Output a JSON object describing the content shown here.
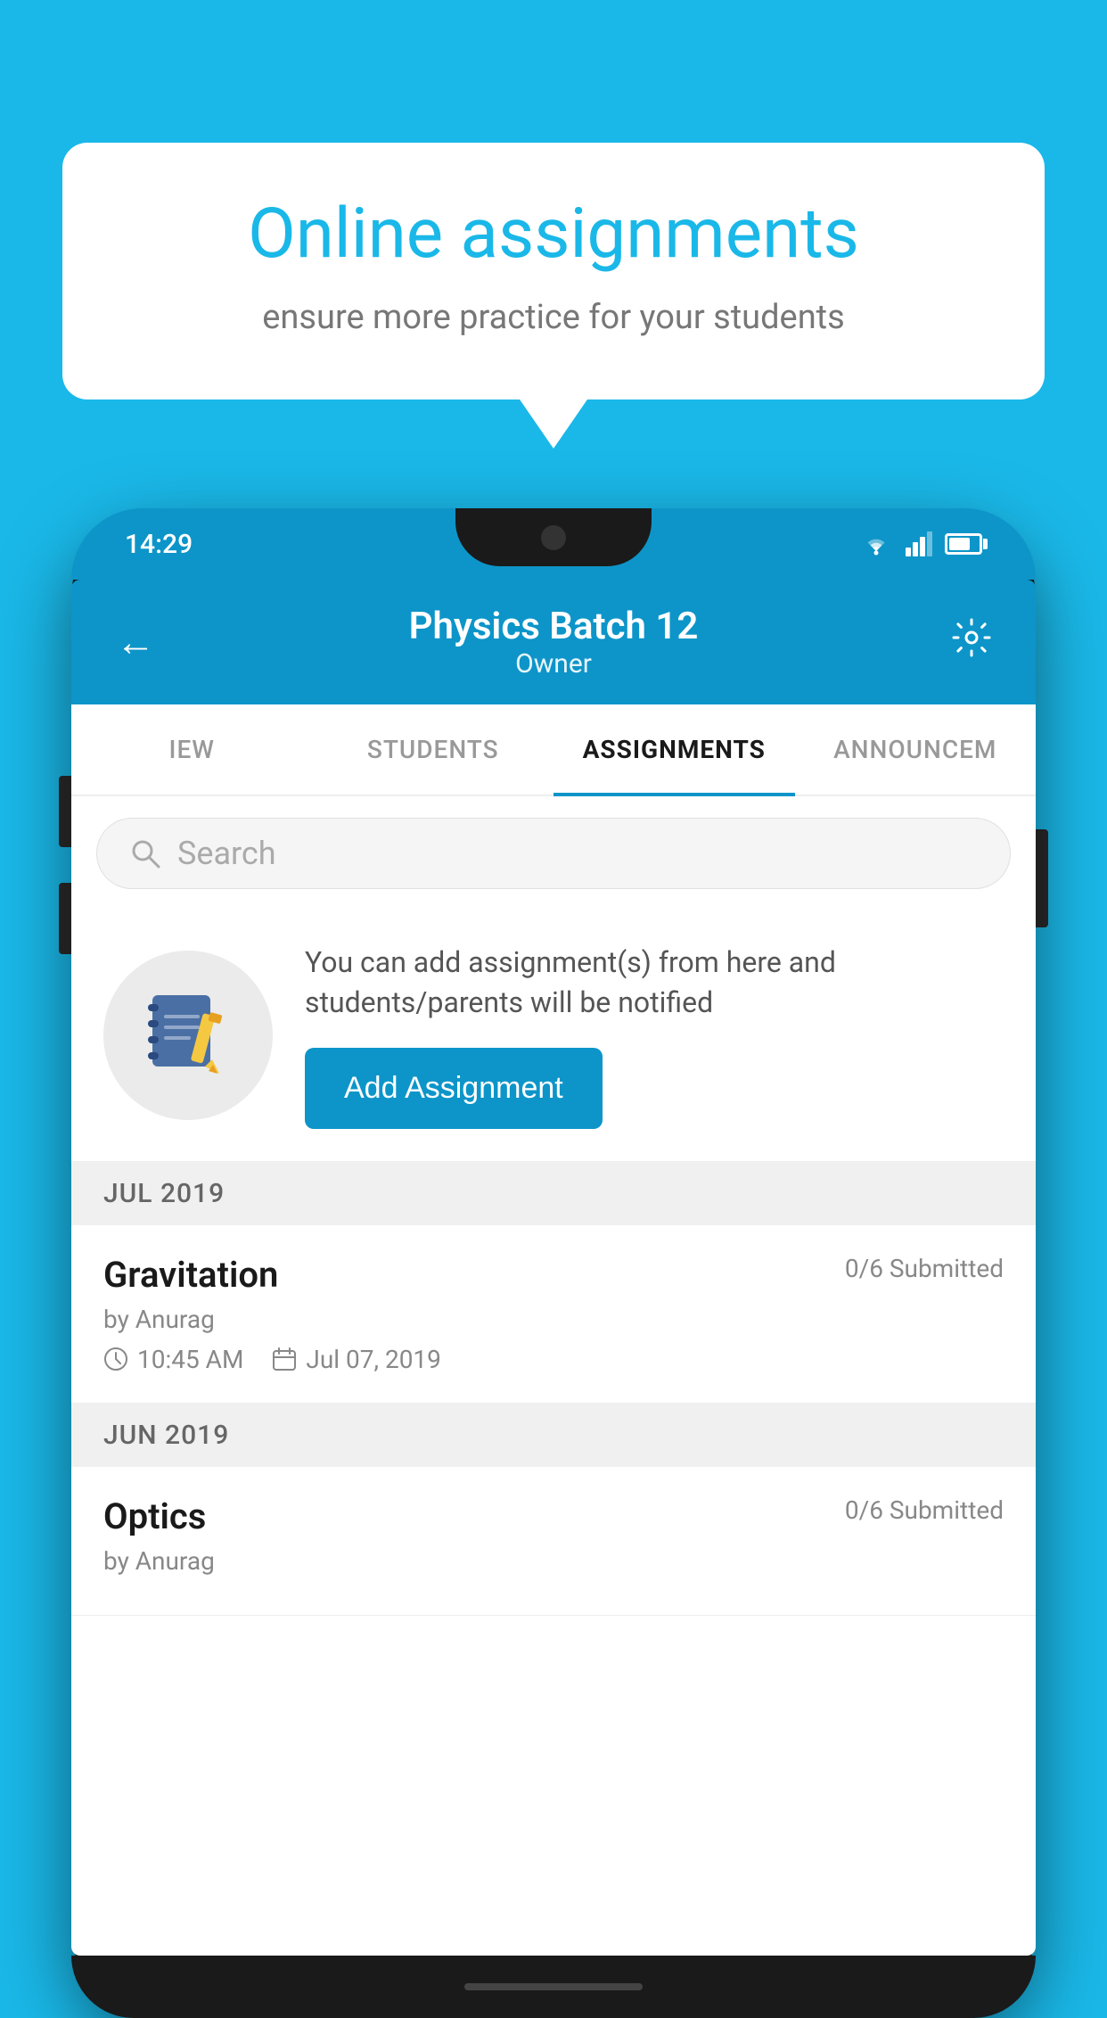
{
  "background_color": "#1ab8e8",
  "speech_bubble": {
    "title": "Online assignments",
    "subtitle": "ensure more practice for your students"
  },
  "phone": {
    "status_bar": {
      "time": "14:29"
    },
    "header": {
      "title": "Physics Batch 12",
      "subtitle": "Owner",
      "back_label": "←",
      "settings_label": "⚙"
    },
    "tabs": [
      {
        "label": "IEW",
        "active": false
      },
      {
        "label": "STUDENTS",
        "active": false
      },
      {
        "label": "ASSIGNMENTS",
        "active": true
      },
      {
        "label": "ANNOUNCEM",
        "active": false
      }
    ],
    "search": {
      "placeholder": "Search"
    },
    "promo": {
      "description": "You can add assignment(s) from here and students/parents will be notified",
      "button_label": "Add Assignment"
    },
    "sections": [
      {
        "month_label": "JUL 2019",
        "assignments": [
          {
            "name": "Gravitation",
            "submitted": "0/6 Submitted",
            "author": "by Anurag",
            "time": "10:45 AM",
            "date": "Jul 07, 2019"
          }
        ]
      },
      {
        "month_label": "JUN 2019",
        "assignments": [
          {
            "name": "Optics",
            "submitted": "0/6 Submitted",
            "author": "by Anurag",
            "time": "",
            "date": ""
          }
        ]
      }
    ]
  }
}
